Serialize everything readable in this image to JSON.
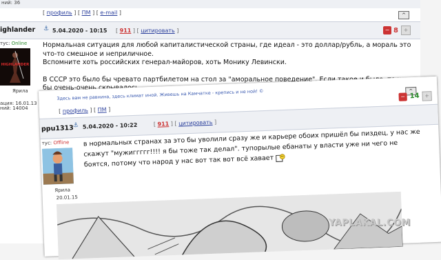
{
  "back_post": {
    "top_side_text": "ний: 36",
    "profile_links": {
      "profile": "профиль",
      "pm": "ПМ",
      "email": "e-mail"
    },
    "up_button": "^",
    "author": {
      "name": "ighlander",
      "status_label": "тус:",
      "status_value": "Online",
      "avatar_text": "HIGHLANDER",
      "group": "Ярила",
      "reg_date": "ация: 16.01.13",
      "messages": "ний: 14004"
    },
    "date": "5.04.2020 - 10:15",
    "post_number": "911",
    "quote_label": "цитировать",
    "rating": {
      "score": "8"
    },
    "paragraphs": [
      "Нормальная ситуация для любой капиталистической страны, где идеал - это доллар/рубль, а мораль это что-то смешное и неприличное.",
      "Вспомните хоть российских генерал-майоров, хоть Монику Левински.",
      "В СССР это было бы чревато партбилетом на стол за \"аморальное поведение\". Если такое и было, то хотя бы очень-очень скрывалось."
    ]
  },
  "front_post": {
    "signature": "Здесь вам не равнина, здесь климат иной. Живешь на Камчатке - крепись и не ной! ©",
    "profile_links": {
      "profile": "профиль",
      "pm": "ПМ"
    },
    "up_button": "^",
    "author": {
      "name": "ppu1313",
      "status_label": "тус:",
      "status_value": "Offline",
      "group": "Ярила",
      "reg_date": "20.01.15"
    },
    "date": "5.04.2020 - 10:22",
    "post_number": "911",
    "quote_label": "цитировать",
    "rating": {
      "score": "14"
    },
    "text": "в нормальных странах за это бы уволили сразу же и карьере обоих пришёл бы пиздец, у нас же скажут \"мужиггггг!!!! я бы тоже так делал\". тупорылые ебанаты у власти уже ни чего не боятся, потому что народ у нас вот так вот всё хавает"
  },
  "watermark": "YAPLAKAL.COM",
  "colors": {
    "link": "#2a3f9c",
    "header_bg": "#eef0f4",
    "online": "#2a8a2a",
    "offline": "#c33",
    "score_green": "#2a8a2a"
  }
}
